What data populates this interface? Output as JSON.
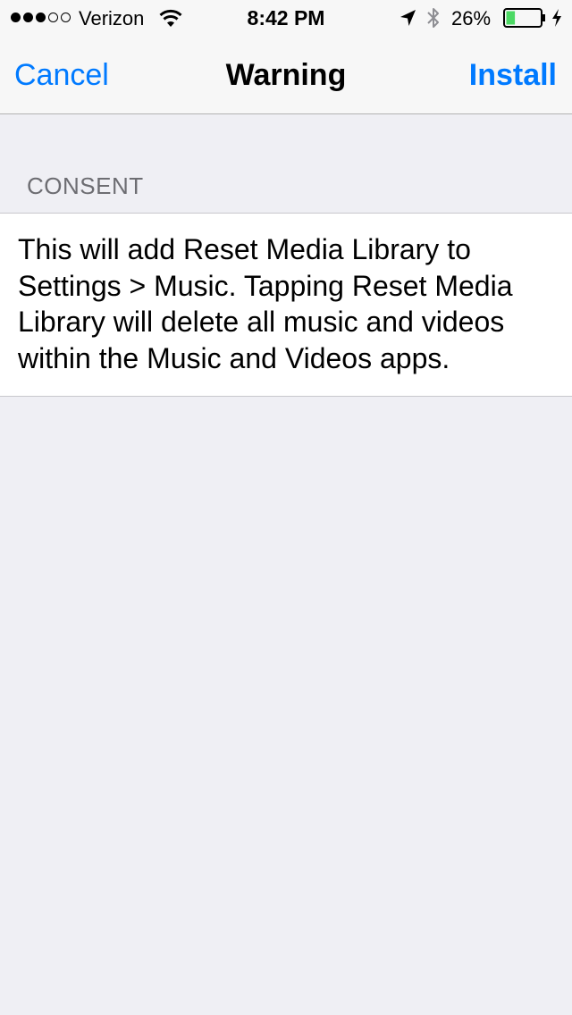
{
  "status_bar": {
    "signal_dots_filled": 3,
    "signal_dots_total": 5,
    "carrier": "Verizon",
    "time": "8:42 PM",
    "battery_percent": "26%",
    "battery_level": 0.26,
    "battery_color": "#4cd964",
    "icons": [
      "wifi-icon",
      "location-icon",
      "bluetooth-icon",
      "battery-icon",
      "charging-icon"
    ]
  },
  "nav": {
    "cancel_label": "Cancel",
    "title": "Warning",
    "install_label": "Install",
    "accent_color": "#007aff"
  },
  "consent": {
    "header": "CONSENT",
    "text": "This will add Reset Media Library to Settings > Music. Tapping Reset Media Library will delete all music and videos within the Music and Videos apps."
  }
}
